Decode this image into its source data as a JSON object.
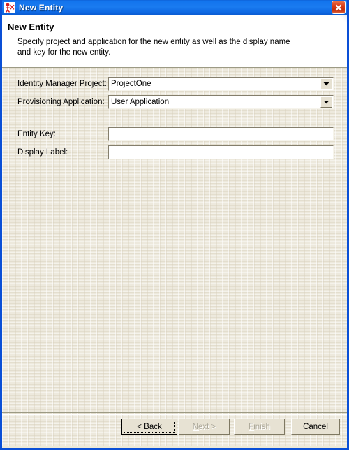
{
  "window": {
    "title": "New Entity",
    "icon": "entity-wizard-icon",
    "close_label": "Close",
    "titlebar_color": "#0F63D9",
    "close_button_color": "#D93B18"
  },
  "header": {
    "title": "New Entity",
    "description": "Specify project and application for the new entity as well as the display name and key for the new entity.",
    "background": "#FFFFFF",
    "accent": "#CEDBF2"
  },
  "form": {
    "fields": [
      {
        "label": "Identity Manager Project:",
        "type": "combobox",
        "value": "ProjectOne",
        "name": "identity-manager-project"
      },
      {
        "label": "Provisioning Application:",
        "type": "combobox",
        "value": "User Application",
        "name": "provisioning-application"
      },
      {
        "label": "Entity Key:",
        "type": "text",
        "value": "",
        "placeholder": "",
        "name": "entity-key"
      },
      {
        "label": "Display Label:",
        "type": "text",
        "value": "",
        "placeholder": "",
        "name": "display-label"
      }
    ]
  },
  "footer": {
    "buttons": [
      {
        "label": "< Back",
        "mnemonic": "B",
        "state": "default",
        "name": "back-button"
      },
      {
        "label": "Next >",
        "mnemonic": "N",
        "state": "disabled",
        "name": "next-button"
      },
      {
        "label": "Finish",
        "mnemonic": "F",
        "state": "disabled",
        "name": "finish-button"
      },
      {
        "label": "Cancel",
        "mnemonic": "",
        "state": "enabled",
        "name": "cancel-button"
      }
    ]
  }
}
